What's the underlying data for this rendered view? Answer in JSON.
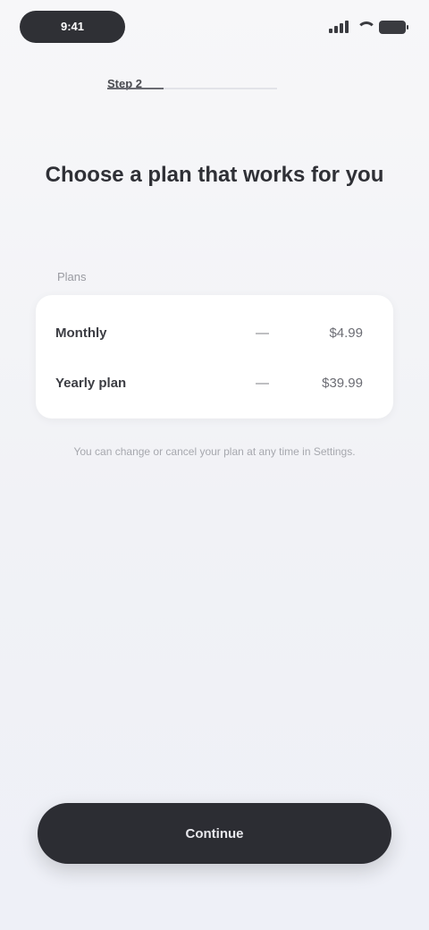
{
  "status_bar": {
    "time": "9:41"
  },
  "progress": {
    "label": "Step 2",
    "fraction": 0.33
  },
  "title": "Choose a plan that works for you",
  "section_label": "Plans",
  "plans": [
    {
      "name": "Monthly",
      "separator": "—",
      "price": "$4.99"
    },
    {
      "name": "Yearly plan",
      "separator": "—",
      "price": "$39.99"
    }
  ],
  "note": "You can change or cancel your plan at any time in Settings.",
  "cta_label": "Continue"
}
